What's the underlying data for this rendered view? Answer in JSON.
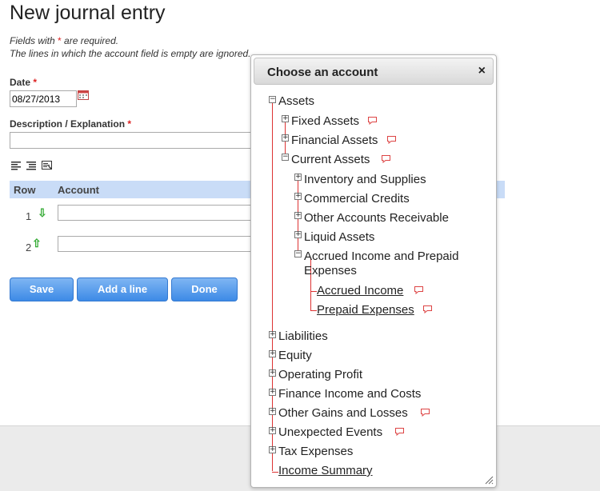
{
  "page": {
    "title": "New journal entry",
    "hint_required_pre": "Fields with ",
    "hint_required_star": "*",
    "hint_required_post": " are required.",
    "hint_empty_lines": "The lines in which the account field is empty are ignored."
  },
  "form": {
    "date_label": "Date",
    "date_value": "08/27/2013",
    "description_label": "Description / Explanation",
    "required_mark": "*"
  },
  "table": {
    "col_row": "Row",
    "col_account": "Account",
    "rows": [
      {
        "number": "1",
        "arrow": "⇩"
      },
      {
        "number": "2",
        "arrow": "⇧"
      }
    ]
  },
  "buttons": {
    "save": "Save",
    "add_line": "Add a line",
    "done": "Done"
  },
  "dialog": {
    "title": "Choose an account",
    "close": "×",
    "tree": [
      {
        "label": "Assets",
        "state": "expanded"
      },
      {
        "label": "Fixed Assets",
        "state": "collapsed"
      },
      {
        "label": "Financial Assets",
        "state": "collapsed"
      },
      {
        "label": "Current Assets",
        "state": "expanded"
      },
      {
        "label": "Inventory and Supplies",
        "state": "collapsed"
      },
      {
        "label": "Commercial Credits",
        "state": "collapsed"
      },
      {
        "label": "Other Accounts Receivable",
        "state": "collapsed"
      },
      {
        "label": "Liquid Assets",
        "state": "collapsed"
      },
      {
        "label": "Accrued Income and Prepaid",
        "label_cont": "Expenses",
        "state": "expanded"
      },
      {
        "label": "Accrued Income",
        "state": "leaf"
      },
      {
        "label": "Prepaid Expenses",
        "state": "leaf"
      },
      {
        "label": "Liabilities",
        "state": "collapsed"
      },
      {
        "label": "Equity",
        "state": "collapsed"
      },
      {
        "label": "Operating Profit",
        "state": "collapsed"
      },
      {
        "label": "Finance Income and Costs",
        "state": "collapsed"
      },
      {
        "label": "Other Gains and Losses",
        "state": "collapsed"
      },
      {
        "label": "Unexpected Events",
        "state": "collapsed"
      },
      {
        "label": "Tax Expenses",
        "state": "collapsed"
      },
      {
        "label": "Income Summary",
        "state": "leaf"
      }
    ]
  },
  "colors": {
    "button": "#3d8ae6",
    "table_header": "#c9dcf7",
    "required": "#dd2222",
    "tree_line": "#dd3333",
    "arrow": "#33aa33"
  }
}
